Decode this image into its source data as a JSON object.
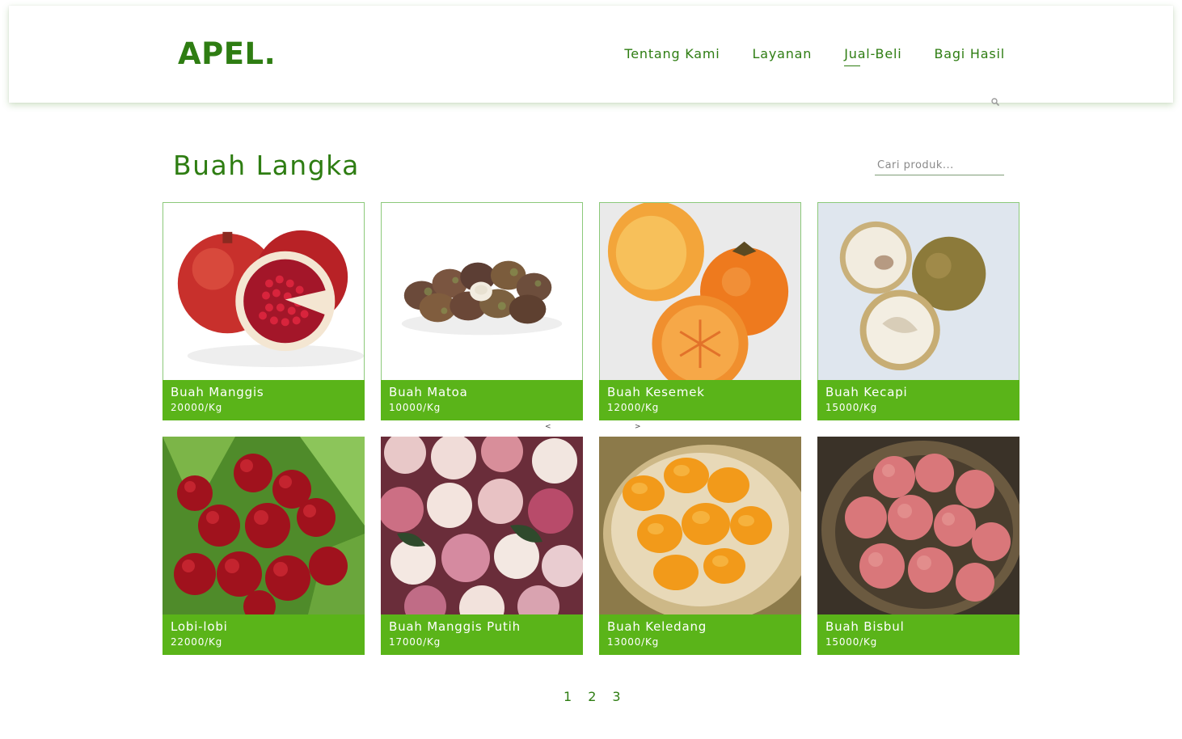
{
  "header": {
    "logo": "APEL.",
    "nav": [
      "Tentang Kami",
      "Layanan",
      "Jual-Beli",
      "Bagi Hasil"
    ],
    "active_nav": "Jual-Beli"
  },
  "main": {
    "title": "Buah Langka",
    "search_placeholder": "Cari produk...",
    "carousel_prev": "<",
    "carousel_next": ">",
    "products": [
      {
        "name": "Buah Manggis",
        "price": "20000/Kg",
        "image": "pomegranate"
      },
      {
        "name": "Buah Matoa",
        "price": "10000/Kg",
        "image": "matoa"
      },
      {
        "name": "Buah Kesemek",
        "price": "12000/Kg",
        "image": "persimmon"
      },
      {
        "name": "Buah Kecapi",
        "price": "15000/Kg",
        "image": "santol"
      },
      {
        "name": "Lobi-lobi",
        "price": "22000/Kg",
        "image": "cherries"
      },
      {
        "name": "Buah Manggis Putih",
        "price": "17000/Kg",
        "image": "rose-apple"
      },
      {
        "name": "Buah Keledang",
        "price": "13000/Kg",
        "image": "jackfruit"
      },
      {
        "name": "Buah Bisbul",
        "price": "15000/Kg",
        "image": "velvet-apple-basket"
      }
    ],
    "pagination": [
      "1",
      "2",
      "3"
    ]
  },
  "colors": {
    "brand_green": "#2e7d12",
    "card_green": "#5ab419"
  }
}
